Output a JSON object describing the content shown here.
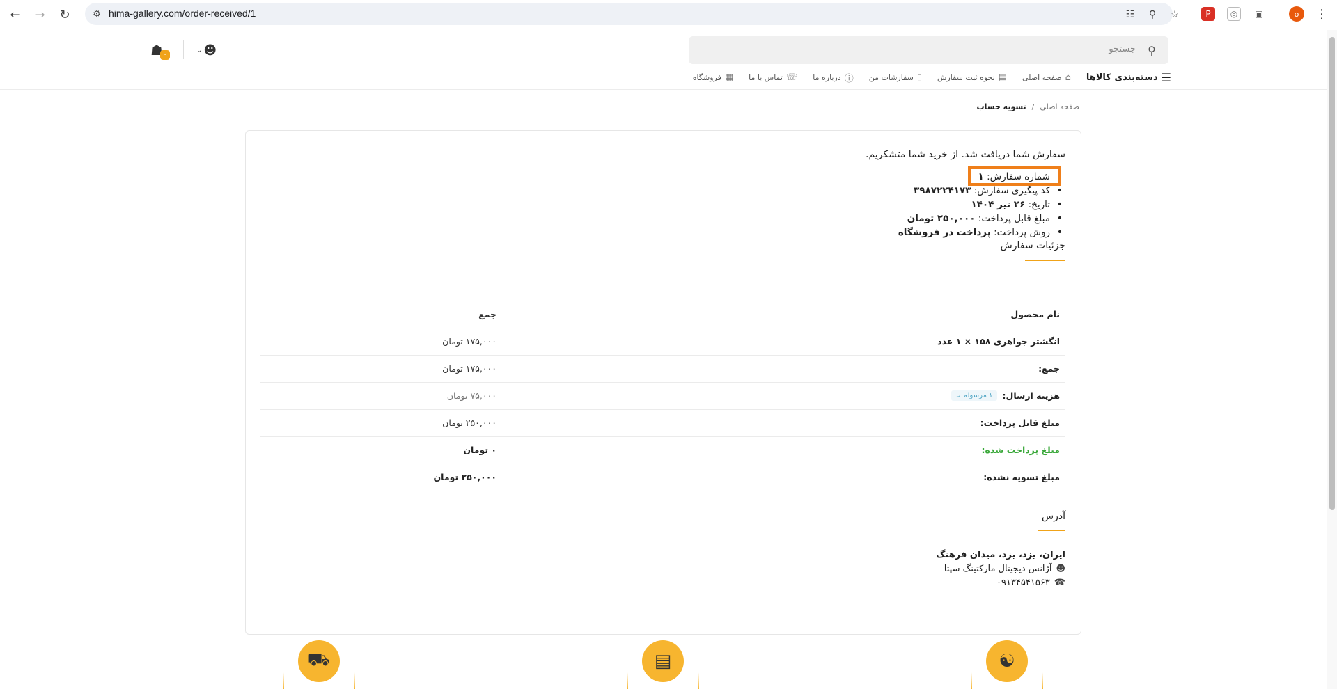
{
  "browser": {
    "url": "hima-gallery.com/order-received/1",
    "profile_initial": "o",
    "icons": [
      "back-icon",
      "forward-icon",
      "reload-icon",
      "site-info-icon",
      "translate-icon",
      "zoom-icon",
      "star-icon",
      "extension-icon",
      "kebab-icon"
    ]
  },
  "header": {
    "search_placeholder": "جستجو",
    "cart_count": "۰"
  },
  "menu": {
    "items": [
      {
        "label": "دسته‌بندی کالاها",
        "icon": "hamburger-icon"
      },
      {
        "label": "صفحه اصلی",
        "icon": "home-icon"
      },
      {
        "label": "نحوه ثبت سفارش",
        "icon": "book-icon"
      },
      {
        "label": "سفارشات من",
        "icon": "box-icon"
      },
      {
        "label": "درباره ما",
        "icon": "info-icon"
      },
      {
        "label": "تماس با ما",
        "icon": "contact-icon"
      },
      {
        "label": "فروشگاه",
        "icon": "store-icon"
      }
    ]
  },
  "breadcrumb": {
    "home": "صفحه اصلی",
    "separator": "/",
    "current": "تسویه حساب"
  },
  "order": {
    "thanks": "سفارش شما دریافت شد. از خرید شما متشکریم.",
    "overview": [
      {
        "label": "شماره سفارش:",
        "value": "۱"
      },
      {
        "label": "کد پیگیری سفارش:",
        "value": "۳۹۸۷۲۲۴۱۷۳"
      },
      {
        "label": "تاریخ:",
        "value": "۲۶ تیر ۱۴۰۴"
      },
      {
        "label": "مبلغ قابل پرداخت:",
        "value": "۲۵۰,۰۰۰ تومان"
      },
      {
        "label": "روش پرداخت:",
        "value": "پرداخت در فروشگاه"
      }
    ]
  },
  "details": {
    "title": "جزئیات سفارش",
    "head": {
      "product": "نام محصول",
      "total": "جمع"
    },
    "rows": [
      {
        "label": "انگشتر جواهری ۱۵۸ × ۱ عدد",
        "value": "۱۷۵,۰۰۰ تومان"
      },
      {
        "label": "جمع:",
        "value": "۱۷۵,۰۰۰ تومان"
      },
      {
        "label": "هزینه ارسال:",
        "value": "۷۵,۰۰۰ تومان",
        "badge": "۱ مرسوله"
      },
      {
        "label": "مبلغ قابل پرداخت:",
        "value": "۲۵۰,۰۰۰ تومان"
      },
      {
        "label": "مبلغ پرداخت شده:",
        "value": "۰ تومان"
      },
      {
        "label": "مبلغ تسویه نشده:",
        "value": "۲۵۰,۰۰۰ تومان"
      }
    ]
  },
  "address": {
    "title": "آدرس",
    "location": "ایران، یزد، یزد، میدان فرهنگ",
    "name": "آژانس دیجیتال مارکتینگ سپتا",
    "phone": "۰۹۱۳۴۵۴۱۵۶۳"
  },
  "colors": {
    "accent": "#f0a319",
    "highlight": "#ef7f1a",
    "paid": "#3aa83a",
    "badge": "#4ba3c3"
  }
}
